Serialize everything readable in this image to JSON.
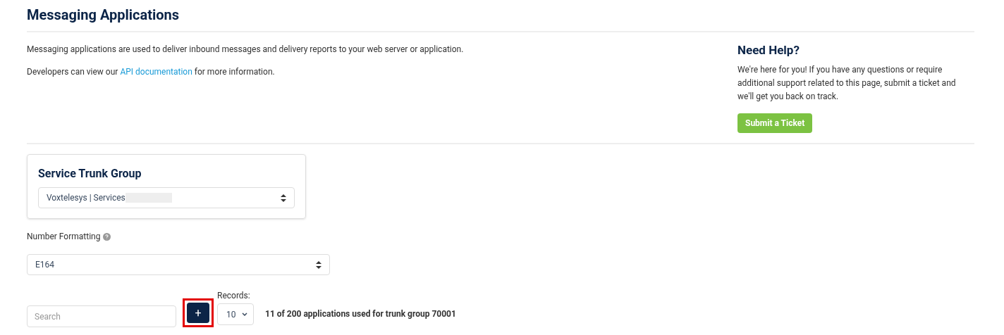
{
  "page_title": "Messaging Applications",
  "intro": {
    "paragraphs": [
      "Messaging applications are used to deliver inbound messages and delivery reports to your web server or application."
    ],
    "link_sentence": {
      "before": "Developers can view our",
      "link": "API documentation",
      "after": "for more information."
    }
  },
  "help": {
    "title": "Need Help?",
    "text": "We're here for you! If you have any questions or require additional support related to this page, submit a ticket and we'll get you back on track.",
    "button": "Submit a Ticket"
  },
  "trunk_group": {
    "title": "Service Trunk Group",
    "value": "Voxtelesys | Services",
    "redacted": true
  },
  "number_formatting": {
    "label": "Number Formatting",
    "value": "E164"
  },
  "toolbar": {
    "search_placeholder": "Search",
    "add_button": {
      "label": "+",
      "highlighted": true
    },
    "records_label": "Records:",
    "records_value": "10",
    "usage": "11 of 200 applications used for trunk group 70001"
  }
}
